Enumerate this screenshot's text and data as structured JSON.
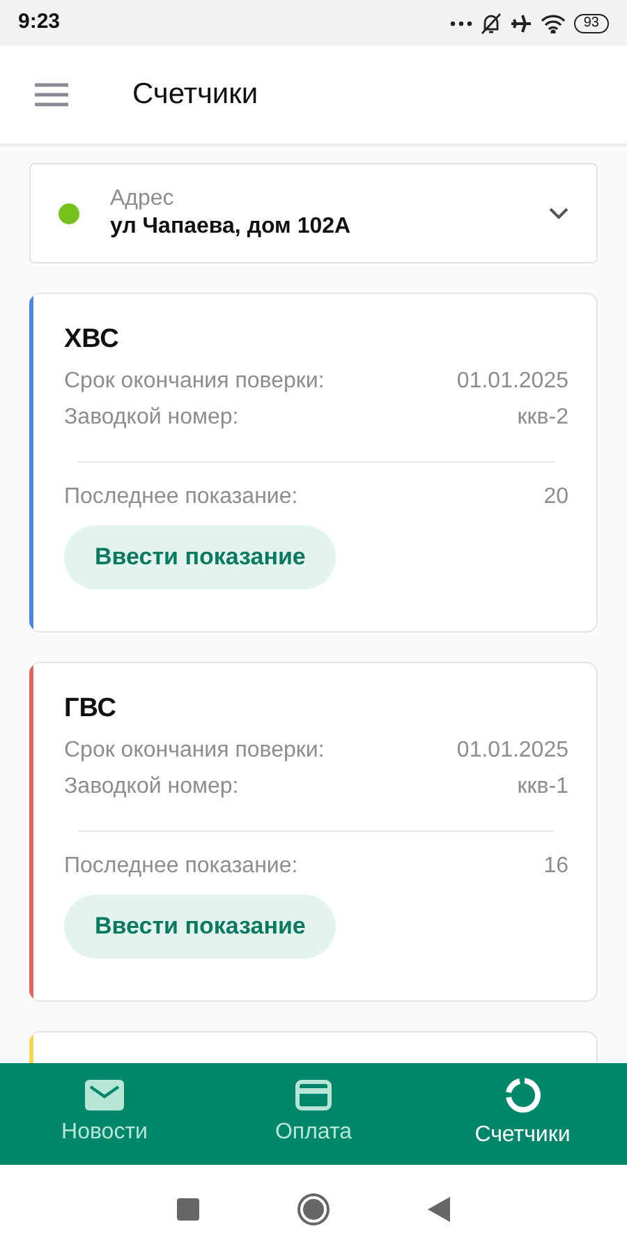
{
  "status_bar": {
    "time": "9:23",
    "battery": "93"
  },
  "header": {
    "title": "Счетчики"
  },
  "address": {
    "label": "Адрес",
    "value": "ул Чапаева, дом 102А",
    "color": "#74c21e"
  },
  "meters": [
    {
      "kind": "full",
      "color": "#4a86e0",
      "name": "ХВС",
      "rows": [
        {
          "label": "Срок окончания поверки:",
          "value": "01.01.2025"
        },
        {
          "label": "Заводкой номер:",
          "value": "ккв-2"
        }
      ],
      "last_label": "Последнее показание:",
      "last_value": "20",
      "button": "Ввести показание"
    },
    {
      "kind": "full",
      "color": "#e0625e",
      "name": "ГВС",
      "rows": [
        {
          "label": "Срок окончания поверки:",
          "value": "01.01.2025"
        },
        {
          "label": "Заводкой номер:",
          "value": "ккв-1"
        }
      ],
      "last_label": "Последнее показание:",
      "last_value": "16",
      "button": "Ввести показание"
    },
    {
      "kind": "cut",
      "color": "#f0d84a"
    }
  ],
  "nav": [
    {
      "kind": "mail",
      "label": "Новости",
      "selected": false
    },
    {
      "kind": "card",
      "label": "Оплата",
      "selected": false
    },
    {
      "kind": "ring",
      "label": "Счетчики",
      "selected": true
    }
  ]
}
